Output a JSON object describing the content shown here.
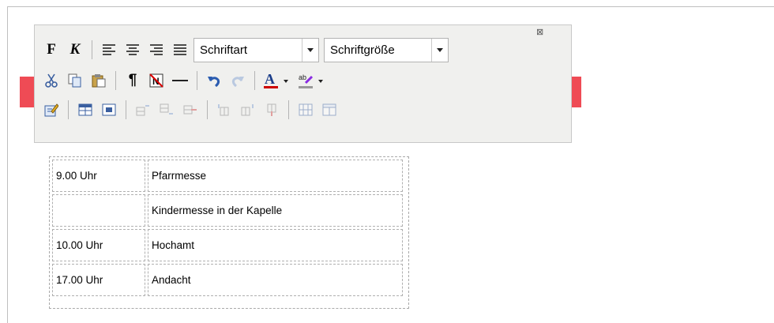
{
  "toolbar": {
    "bold_label": "F",
    "italic_label": "K",
    "font_select": {
      "value": "Schriftart"
    },
    "size_select": {
      "value": "Schriftgröße"
    },
    "close_label": "⊠",
    "colors": {
      "red_strip": "#ef4b55",
      "font_color_bar": "#cc0000",
      "highlight_bar": "#999999"
    }
  },
  "schedule": {
    "rows": [
      {
        "time": "9.00 Uhr",
        "event": "Pfarrmesse"
      },
      {
        "time": "",
        "event": "Kindermesse in der Kapelle"
      },
      {
        "time": "10.00 Uhr",
        "event": "Hochamt"
      },
      {
        "time": "17.00 Uhr",
        "event": "Andacht"
      }
    ]
  }
}
